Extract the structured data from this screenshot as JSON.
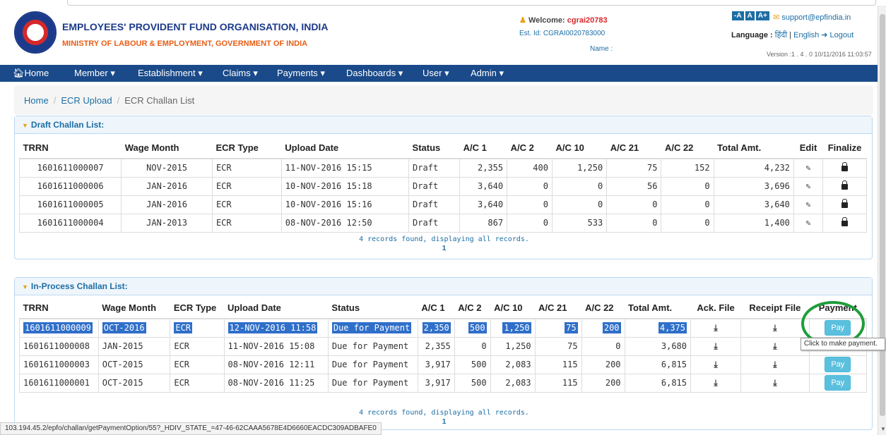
{
  "header": {
    "org_title": "EMPLOYEES' PROVIDENT FUND ORGANISATION, INDIA",
    "org_subtitle": "MINISTRY OF LABOUR & EMPLOYMENT, GOVERNMENT OF INDIA",
    "welcome_label": "Welcome:",
    "welcome_user": "cgrai20783",
    "est_id": "Est. Id: CGRAI0020783000",
    "name_label": "Name :",
    "font_small": "-A",
    "font_normal": "A",
    "font_large": "A+",
    "support_email": "support@epfindia.in",
    "language_label": "Language :",
    "lang_hindi": "हिंदी",
    "lang_english": "English",
    "logout": "Logout",
    "version": "Version :1 . 4 . 0 10/11/2016 11:03:57"
  },
  "nav": {
    "items": [
      {
        "label": "Home"
      },
      {
        "label": "Member"
      },
      {
        "label": "Establishment"
      },
      {
        "label": "Claims"
      },
      {
        "label": "Payments"
      },
      {
        "label": "Dashboards"
      },
      {
        "label": "User"
      },
      {
        "label": "Admin"
      }
    ]
  },
  "breadcrumb": {
    "home": "Home",
    "ecr_upload": "ECR Upload",
    "current": "ECR Challan List"
  },
  "draft": {
    "title": "Draft Challan List:",
    "headers": [
      "TRRN",
      "Wage Month",
      "ECR Type",
      "Upload Date",
      "Status",
      "A/C 1",
      "A/C 2",
      "A/C 10",
      "A/C 21",
      "A/C 22",
      "Total Amt.",
      "Edit",
      "Finalize"
    ],
    "rows": [
      [
        "1601611000007",
        "NOV-2015",
        "ECR",
        "11-NOV-2016 15:15",
        "Draft",
        "2,355",
        "400",
        "1,250",
        "75",
        "152",
        "4,232"
      ],
      [
        "1601611000006",
        "JAN-2016",
        "ECR",
        "10-NOV-2016 15:18",
        "Draft",
        "3,640",
        "0",
        "0",
        "56",
        "0",
        "3,696"
      ],
      [
        "1601611000005",
        "JAN-2016",
        "ECR",
        "10-NOV-2016 15:16",
        "Draft",
        "3,640",
        "0",
        "0",
        "0",
        "0",
        "3,640"
      ],
      [
        "1601611000004",
        "JAN-2013",
        "ECR",
        "08-NOV-2016 12:50",
        "Draft",
        "867",
        "0",
        "533",
        "0",
        "0",
        "1,400"
      ]
    ],
    "records_text": "4 records found, displaying all records.",
    "page": "1"
  },
  "inprocess": {
    "title": "In-Process Challan List:",
    "headers": [
      "TRRN",
      "Wage Month",
      "ECR Type",
      "Upload Date",
      "Status",
      "A/C 1",
      "A/C 2",
      "A/C 10",
      "A/C 21",
      "A/C 22",
      "Total Amt.",
      "Ack. File",
      "Receipt File",
      "Payment"
    ],
    "rows": [
      [
        "1601611000009",
        "OCT-2016",
        "ECR",
        "12-NOV-2016 11:58",
        "Due for Payment",
        "2,350",
        "500",
        "1,250",
        "75",
        "200",
        "4,375"
      ],
      [
        "1601611000008",
        "JAN-2015",
        "ECR",
        "11-NOV-2016 15:08",
        "Due for Payment",
        "2,355",
        "0",
        "1,250",
        "75",
        "0",
        "3,680"
      ],
      [
        "1601611000003",
        "OCT-2015",
        "ECR",
        "08-NOV-2016 12:11",
        "Due for Payment",
        "3,917",
        "500",
        "2,083",
        "115",
        "200",
        "6,815"
      ],
      [
        "1601611000001",
        "OCT-2015",
        "ECR",
        "08-NOV-2016 11:25",
        "Due for Payment",
        "3,917",
        "500",
        "2,083",
        "115",
        "200",
        "6,815"
      ]
    ],
    "pay_label": "Pay",
    "records_text": "4 records found, displaying all records.",
    "page": "1"
  },
  "tooltip": "Click to make payment.",
  "status_url": "103.194.45.2/epfo/challan/getPaymentOption/55?_HDIV_STATE_=47-46-62CAAA5678E4D6660EACDC309ADBAFE0"
}
